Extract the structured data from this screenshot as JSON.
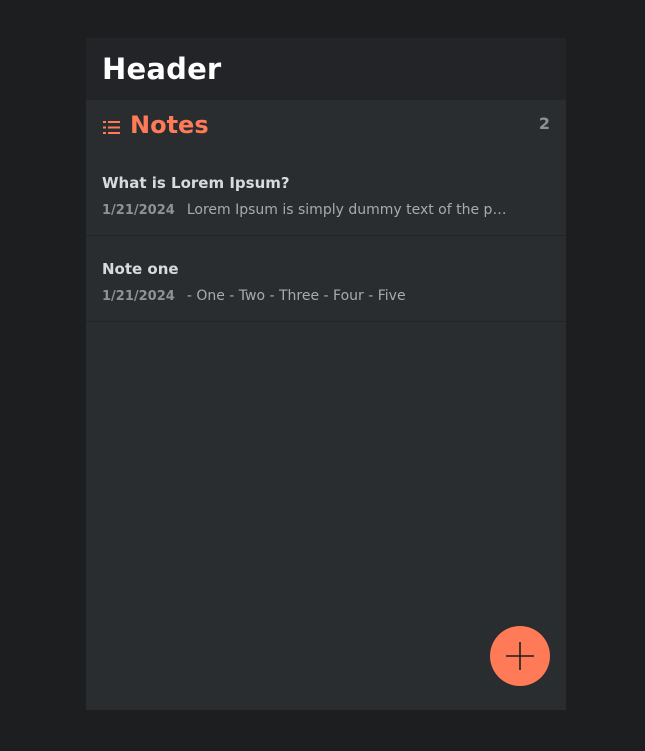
{
  "header": {
    "title": "Header"
  },
  "notes_section": {
    "title": "Notes",
    "count": "2",
    "icon": "list-icon"
  },
  "notes": [
    {
      "title": "What is Lorem Ipsum?",
      "date": "1/21/2024",
      "preview": "Lorem Ipsum is simply dummy text of the printing and typesetting industry."
    },
    {
      "title": "Note one",
      "date": "1/21/2024",
      "preview": "- One - Two - Three - Four - Five"
    }
  ],
  "fab": {
    "icon": "plus-icon"
  },
  "colors": {
    "accent": "#ff7a57",
    "background": "#1d1e20",
    "panel": "#2a2d30",
    "header": "#222427"
  }
}
